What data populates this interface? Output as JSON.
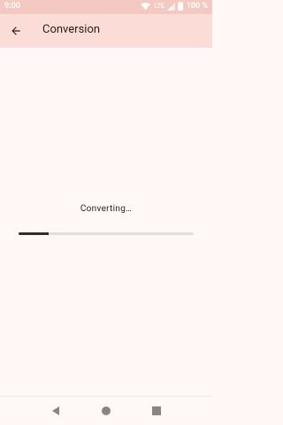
{
  "status_bar": {
    "time": "9:00",
    "network": "LTE",
    "battery": "100 %"
  },
  "app_bar": {
    "title": "Conversion",
    "back_icon": "arrow-back-icon"
  },
  "main": {
    "status_text": "Converting…",
    "progress": 0.17
  },
  "colors": {
    "status_bar": "#f4c9c2",
    "app_bar": "#fbdcd6",
    "background": "#fff8f6",
    "progress_fill": "#3b2a28",
    "progress_track": "#e5dcd9"
  },
  "nav_bar": {
    "back_icon": "triangle-back-icon",
    "home_icon": "circle-home-icon",
    "recents_icon": "square-recents-icon"
  }
}
